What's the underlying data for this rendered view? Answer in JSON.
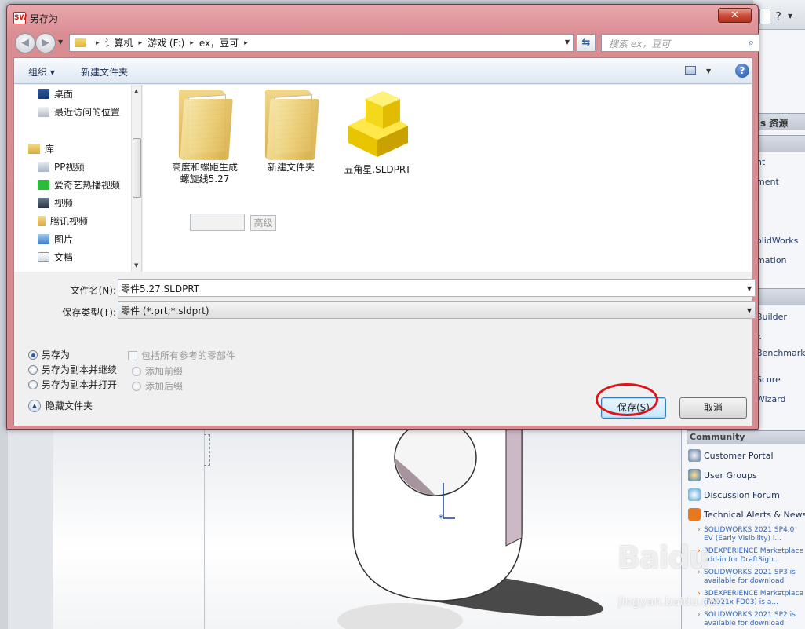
{
  "dialog": {
    "title": "另存为",
    "app_icon_text": "SW",
    "close_glyph": "✕"
  },
  "address": {
    "segments": [
      "计算机",
      "游戏 (F:)",
      "ex，豆可"
    ],
    "separator": "▸"
  },
  "search": {
    "placeholder": "搜索 ex，豆可"
  },
  "toolbar": {
    "organize_label": "组织 ▾",
    "new_folder_label": "新建文件夹",
    "help_glyph": "?"
  },
  "nav_pane": {
    "items": [
      {
        "label": "桌面",
        "icon": "desktop-icon",
        "group": false
      },
      {
        "label": "最近访问的位置",
        "icon": "recent-places-icon",
        "group": false
      },
      {
        "label": "库",
        "icon": "library-icon",
        "group": true
      },
      {
        "label": "PP视频",
        "icon": "pptv-icon",
        "group": false
      },
      {
        "label": "爱奇艺热播视频",
        "icon": "iqiyi-icon",
        "group": false
      },
      {
        "label": "视频",
        "icon": "video-icon",
        "group": false
      },
      {
        "label": "腾讯视频",
        "icon": "tencent-video-icon",
        "group": false
      },
      {
        "label": "图片",
        "icon": "pictures-icon",
        "group": false
      },
      {
        "label": "文档",
        "icon": "documents-icon",
        "group": false
      }
    ]
  },
  "files": [
    {
      "name_line1": "高度和螺距生成",
      "name_line2": "螺旋线5.27",
      "icon": "folder-icon"
    },
    {
      "name_line1": "新建文件夹",
      "name_line2": "",
      "icon": "folder-icon"
    },
    {
      "name_line1": "五角星.SLDPRT",
      "name_line2": "",
      "icon": "solidworks-part-icon"
    }
  ],
  "form": {
    "filename_label": "文件名(N):",
    "filename_value": "零件5.27.SLDPRT",
    "filetype_label": "保存类型(T):",
    "filetype_value": "零件 (*.prt;*.sldprt)"
  },
  "options": {
    "radios": [
      "另存为",
      "另存为副本并继续",
      "另存为副本并打开"
    ],
    "selected_radio": "另存为",
    "include_refs_label": "包括所有参考的零部件",
    "add_prefix_label": "添加前缀",
    "add_suffix_label": "添加后缀",
    "advanced_label": "高级"
  },
  "footer": {
    "hide_folders_label": "隐藏文件夹",
    "save_label": "保存(S)",
    "cancel_label": "取消"
  },
  "task_pane": {
    "resources_header": "s 资源",
    "items_a": [
      "nt",
      "ment",
      "olidWorks",
      "mation"
    ],
    "items_b": [
      "Builder",
      "k",
      "Benchmark",
      "Score",
      "Wizard"
    ],
    "community_header": "Community",
    "community_items": [
      "Customer Portal",
      "User Groups",
      "Discussion Forum",
      "Technical Alerts & News"
    ],
    "news": [
      "SOLIDWORKS 2021 SP4.0 EV (Early Visibility) i...",
      "3DEXPERIENCE Marketplace add-in for DraftSigh...",
      "SOLIDWORKS 2021 SP3 is available for download",
      "3DEXPERIENCE Marketplace (R2021x FD03) is a...",
      "SOLIDWORKS 2021 SP2 is available for download"
    ]
  },
  "bg_topbar": {
    "help_glyph": "?"
  },
  "watermark": {
    "brand": "Baidu",
    "sub": "jingyan.baidu.com"
  },
  "colors": {
    "dialog_frame": "#d98c92",
    "highlight_circle": "#e0131a",
    "primary_button": "#bee6fd"
  }
}
